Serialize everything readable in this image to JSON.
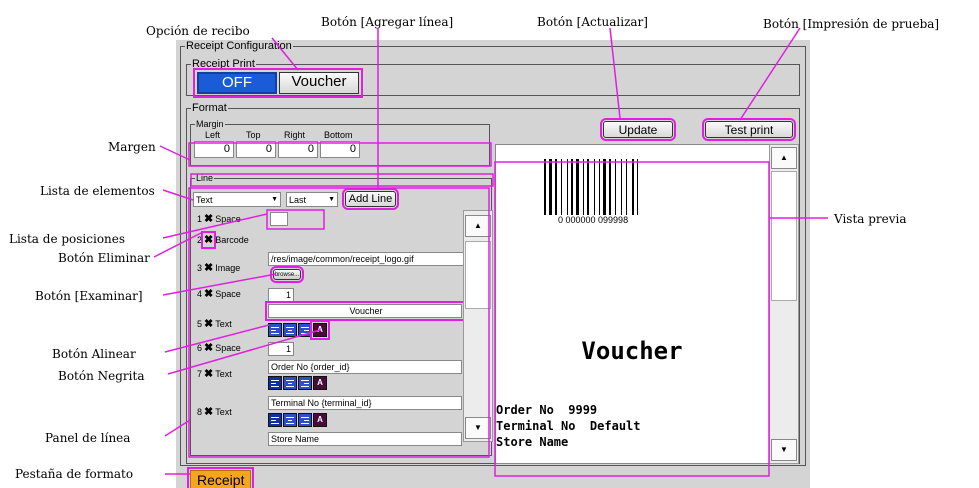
{
  "annotations": {
    "receipt_option": "Opción de recibo",
    "add_line_button": "Botón [Agregar línea]",
    "update_button": "Botón [Actualizar]",
    "test_print_button": "Botón [Impresión de prueba]",
    "margin": "Margen",
    "element_list": "Lista de elementos",
    "position_list": "Lista de posiciones",
    "delete_button": "Botón Eliminar",
    "browse_button": "Botón [Examinar]",
    "align_button": "Botón Alinear",
    "bold_button": "Botón Negrita",
    "line_panel": "Panel de línea",
    "format_tab": "Pestaña de formato",
    "preview": "Vista previa"
  },
  "config": {
    "title": "Receipt Configuration",
    "receipt_print": {
      "title": "Receipt Print",
      "off_label": "OFF",
      "voucher_label": "Voucher"
    },
    "format": {
      "title": "Format",
      "margin": {
        "title": "Margin",
        "labels": [
          "Left",
          "Top",
          "Right",
          "Bottom"
        ],
        "values": [
          "0",
          "0",
          "0",
          "0"
        ]
      },
      "update_label": "Update",
      "test_print_label": "Test print",
      "line": {
        "title": "Line",
        "element_select": "Text",
        "position_select": "Last",
        "add_line_label": "Add Line",
        "rows": [
          {
            "num": "1",
            "type": "Space",
            "value": ""
          },
          {
            "num": "2",
            "type": "Barcode",
            "value": ""
          },
          {
            "num": "3",
            "type": "Image",
            "value": "/res/image/common/receipt_logo.gif"
          },
          {
            "num": "4",
            "type": "Space",
            "value": "1"
          },
          {
            "num": "5",
            "type": "Text",
            "value": "Voucher"
          },
          {
            "num": "6",
            "type": "Space",
            "value": "1"
          },
          {
            "num": "7",
            "type": "Text",
            "value": "Order No {order_id}"
          },
          {
            "num": "8",
            "type": "Text",
            "value": "Terminal No {terminal_id}"
          },
          {
            "num": "9",
            "type": "Text",
            "value": "Store Name"
          }
        ],
        "browse_label": "browse..."
      }
    },
    "preview": {
      "barcode_number": "0 000000 099998",
      "title": "Voucher",
      "lines": [
        "Order No  9999",
        "Terminal No  Default",
        "Store Name"
      ]
    },
    "tab_label": "Receipt"
  },
  "colors": {
    "highlight": "#e020e0",
    "toggle_active": "#1a5bd8",
    "tab": "#f5a61e"
  }
}
